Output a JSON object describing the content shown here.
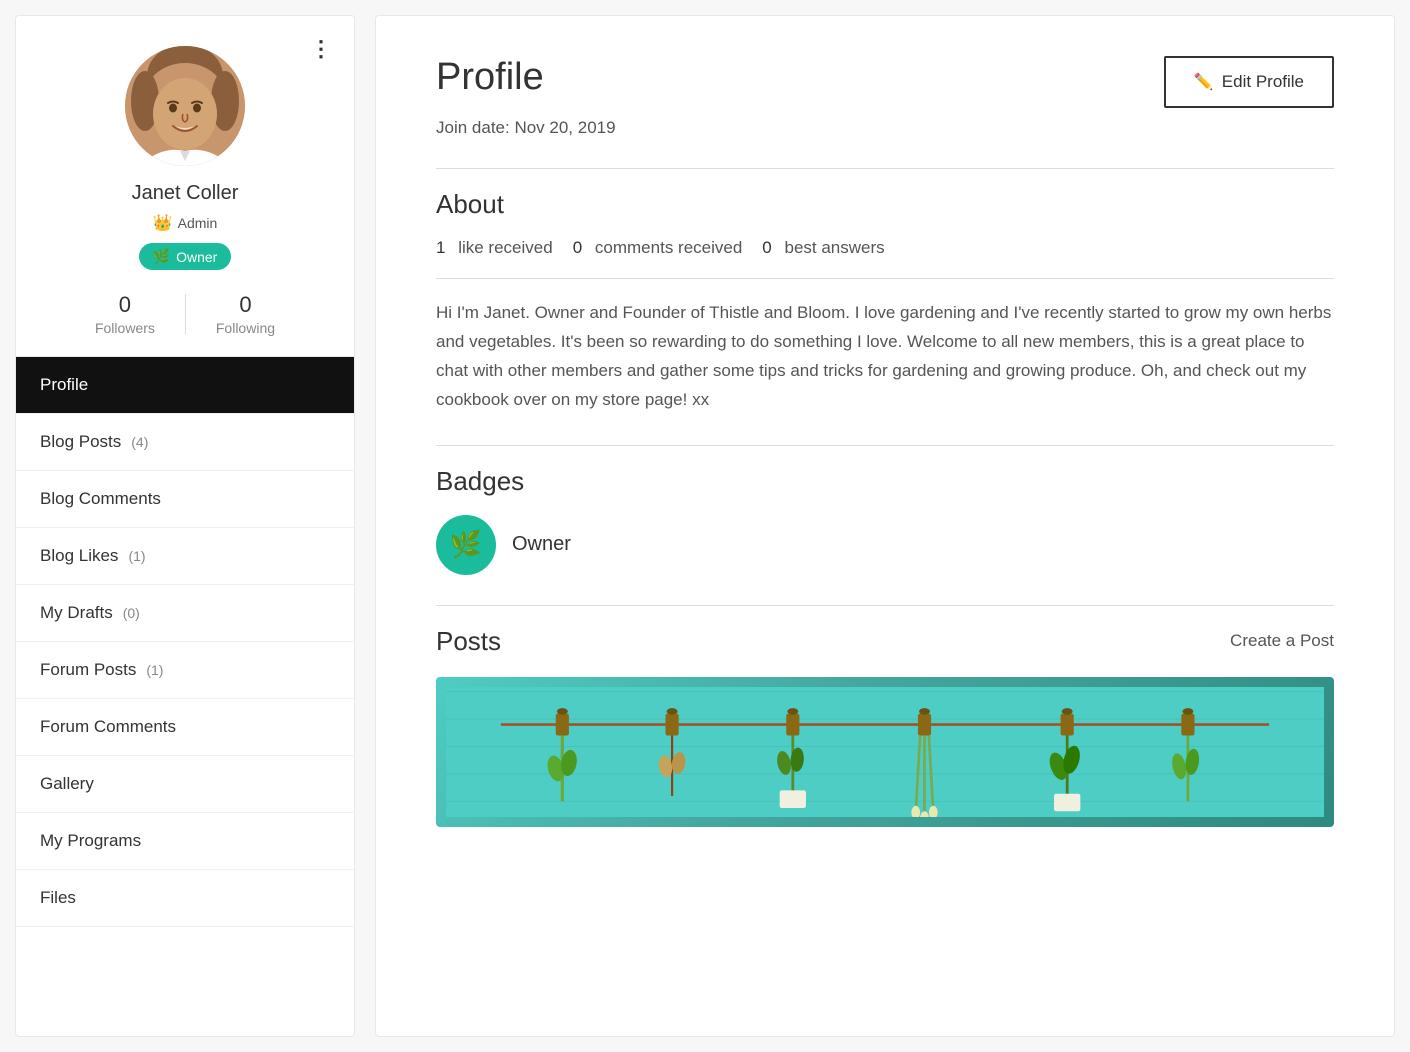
{
  "sidebar": {
    "user": {
      "name": "Janet Coller",
      "admin_label": "Admin",
      "owner_label": "Owner",
      "followers_count": "0",
      "following_count": "0",
      "followers_label": "Followers",
      "following_label": "Following"
    },
    "nav_items": [
      {
        "id": "profile",
        "label": "Profile",
        "count": null,
        "active": true
      },
      {
        "id": "blog-posts",
        "label": "Blog Posts",
        "count": "4",
        "active": false
      },
      {
        "id": "blog-comments",
        "label": "Blog Comments",
        "count": null,
        "active": false
      },
      {
        "id": "blog-likes",
        "label": "Blog Likes",
        "count": "1",
        "active": false
      },
      {
        "id": "my-drafts",
        "label": "My Drafts",
        "count": "0",
        "active": false
      },
      {
        "id": "forum-posts",
        "label": "Forum Posts",
        "count": "1",
        "active": false
      },
      {
        "id": "forum-comments",
        "label": "Forum Comments",
        "count": null,
        "active": false
      },
      {
        "id": "gallery",
        "label": "Gallery",
        "count": null,
        "active": false
      },
      {
        "id": "my-programs",
        "label": "My Programs",
        "count": null,
        "active": false
      },
      {
        "id": "files",
        "label": "Files",
        "count": null,
        "active": false
      }
    ],
    "three_dots": "⋮"
  },
  "main": {
    "page_title": "Profile",
    "edit_profile_label": "Edit Profile",
    "join_date_label": "Join date: Nov 20, 2019",
    "about_section": {
      "title": "About",
      "stats": [
        {
          "number": "1",
          "label": "like received"
        },
        {
          "number": "0",
          "label": "comments received"
        },
        {
          "number": "0",
          "label": "best answers"
        }
      ],
      "bio": "Hi I'm Janet. Owner and Founder of Thistle and Bloom. I love gardening and I've recently started to grow my own herbs and vegetables. It's been so rewarding to do something I love. Welcome to all new members, this is a great place to chat with other members and gather some tips and tricks for gardening and growing produce. Oh, and check out my cookbook over on my store page! xx"
    },
    "badges_section": {
      "title": "Badges",
      "badge_name": "Owner"
    },
    "posts_section": {
      "title": "Posts",
      "create_post_label": "Create a Post"
    }
  }
}
